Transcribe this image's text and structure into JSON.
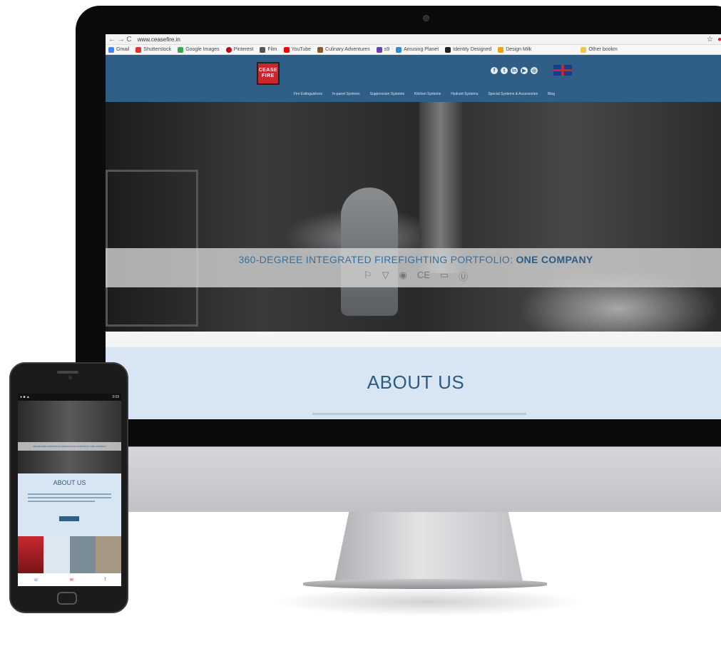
{
  "browser": {
    "url": "www.ceasefire.in",
    "bookmarks": [
      "Gmail",
      "Shutterstock",
      "Google Images",
      "Pinterest",
      "Film",
      "YouTube",
      "Culinary Adventures",
      "s9",
      "Amusing Planet",
      "Identity Designed",
      "Design Milk",
      "Other bookm"
    ]
  },
  "site": {
    "logo_line1": "CEASE",
    "logo_line2": "FIRE",
    "nav": [
      "Fire Extinguishers",
      "In-panel Systems",
      "Suppression Systems",
      "Kitchen Systems",
      "Hydrant Systems",
      "Special Systems & Accessories",
      "Blog"
    ],
    "social_icons": [
      "facebook-icon",
      "twitter-icon",
      "linkedin-icon",
      "youtube-icon",
      "instagram-icon"
    ],
    "hero": {
      "headline_regular": "360-DEGREE INTEGRATED FIREFIGHTING PORTFOLIO:",
      "headline_bold": "ONE COMPANY",
      "cert_icons": [
        "isi-mark-icon",
        "bis-icon",
        "ce-mark-icon",
        "vds-icon",
        "ul-icon",
        "fm-icon"
      ]
    },
    "about_title": "ABOUT US"
  },
  "phone": {
    "status_time": "3:09",
    "about_title": "ABOUT US",
    "banner_text": "360-DEGREE INTEGRATED FIREFIGHTING PORTFOLIO: ONE COMPANY"
  },
  "colors": {
    "header_blue": "#2f5f87",
    "brand_red": "#c8272e",
    "about_bg": "#d7e6f2"
  }
}
